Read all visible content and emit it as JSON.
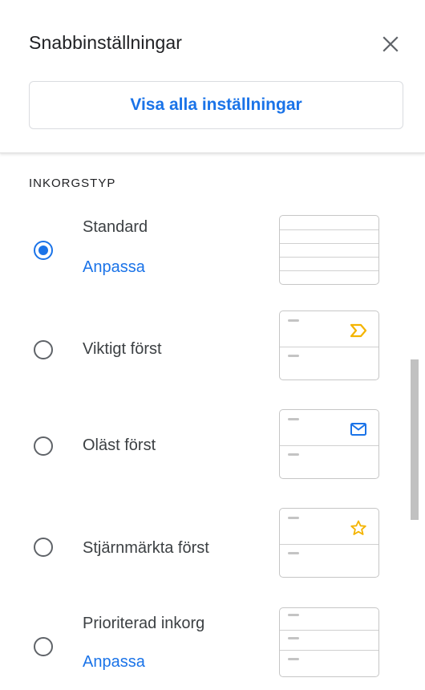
{
  "header": {
    "title": "Snabbinställningar",
    "close_icon": "close-icon",
    "all_settings_label": "Visa alla inställningar"
  },
  "inbox_type": {
    "section_label": "INKORGSTYP",
    "options": [
      {
        "label": "Standard",
        "checked": true,
        "customize_label": "Anpassa",
        "thumb": "standard"
      },
      {
        "label": "Viktigt först",
        "checked": false,
        "thumb": "important-icon"
      },
      {
        "label": "Oläst först",
        "checked": false,
        "thumb": "mail-icon"
      },
      {
        "label": "Stjärnmärkta först",
        "checked": false,
        "thumb": "star-icon"
      },
      {
        "label": "Prioriterad inkorg",
        "checked": false,
        "customize_label": "Anpassa",
        "thumb": "priority"
      }
    ]
  },
  "colors": {
    "accent": "#1a73e8",
    "important": "#f4b400",
    "star": "#f4b400"
  }
}
